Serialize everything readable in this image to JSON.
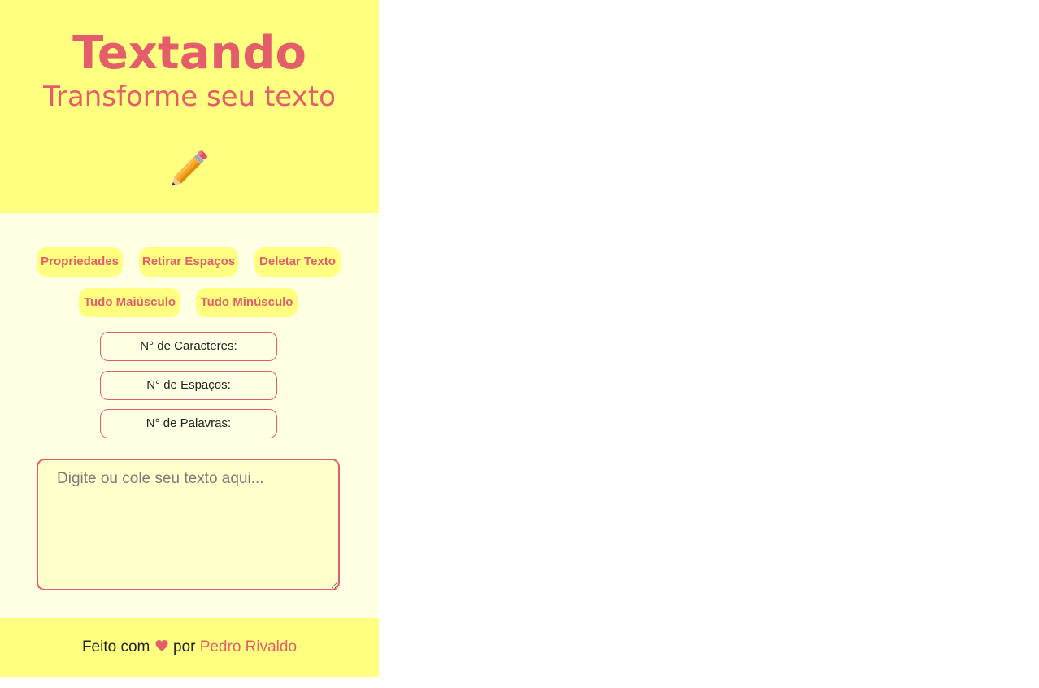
{
  "header": {
    "title": "Textando",
    "subtitle": "Transforme seu texto",
    "icon": "pencil-icon"
  },
  "buttons": {
    "properties": "Propriedades",
    "remove_spaces": "Retirar Espaços",
    "delete_text": "Deletar Texto",
    "uppercase": "Tudo Maiúsculo",
    "lowercase": "Tudo Minúsculo"
  },
  "stats": {
    "characters": "N° de Caracteres:",
    "spaces": "N° de Espaços:",
    "words": "N° de Palavras:"
  },
  "editor": {
    "value": "",
    "placeholder": "Digite ou cole seu texto aqui..."
  },
  "footer": {
    "prefix": "Feito com",
    "heart_icon": "heart-icon",
    "middle": "por",
    "author": "Pedro Rivaldo"
  },
  "colors": {
    "accent": "#e35d6a",
    "header_bg": "#ffff80",
    "body_bg": "#ffffe3",
    "textarea_bg": "#ffffcc"
  }
}
